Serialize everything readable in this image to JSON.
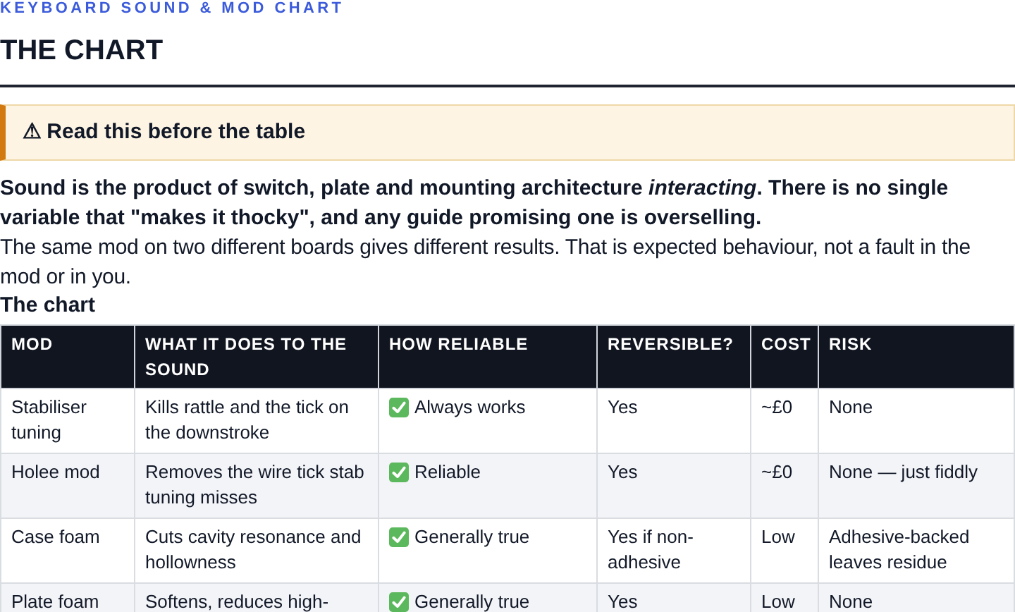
{
  "eyebrow": "KEYBOARD SOUND & MOD CHART",
  "title": "THE CHART",
  "callout": {
    "icon": "⚠",
    "text": "Read this before the table"
  },
  "lead": "Sound is the product of switch, plate and mounting architecture *interacting*. There is no single variable that \"makes it thocky\", and any guide promising one is overselling.",
  "body": "The same mod on two different boards gives different results. That is expected behaviour, not a fault in the mod or in you.",
  "section_heading": "The chart",
  "table": {
    "columns": [
      "MOD",
      "WHAT IT DOES TO THE SOUND",
      "HOW RELIABLE",
      "REVERSIBLE?",
      "COST",
      "RISK"
    ],
    "rows": [
      {
        "mod": "Stabiliser tuning",
        "effect": "Kills rattle and the tick on the downstroke",
        "reliability": {
          "kind": "check",
          "text": "Always works"
        },
        "reversible": "Yes",
        "cost": "~£0",
        "risk": "None"
      },
      {
        "mod": "Holee mod",
        "effect": "Removes the wire tick stab tuning misses",
        "reliability": {
          "kind": "check",
          "text": "Reliable"
        },
        "reversible": "Yes",
        "cost": "~£0",
        "risk": "None — just fiddly"
      },
      {
        "mod": "Case foam",
        "effect": "Cuts cavity resonance and hollowness",
        "reliability": {
          "kind": "check",
          "text": "Generally true"
        },
        "reversible": "Yes if non-adhesive",
        "cost": "Low",
        "risk": "Adhesive-backed leaves residue"
      },
      {
        "mod": "Plate foam",
        "effect": "Softens, reduces high-",
        "reliability": {
          "kind": "check",
          "text": "Generally true"
        },
        "reversible": "Yes",
        "cost": "Low",
        "risk": "None"
      }
    ]
  }
}
